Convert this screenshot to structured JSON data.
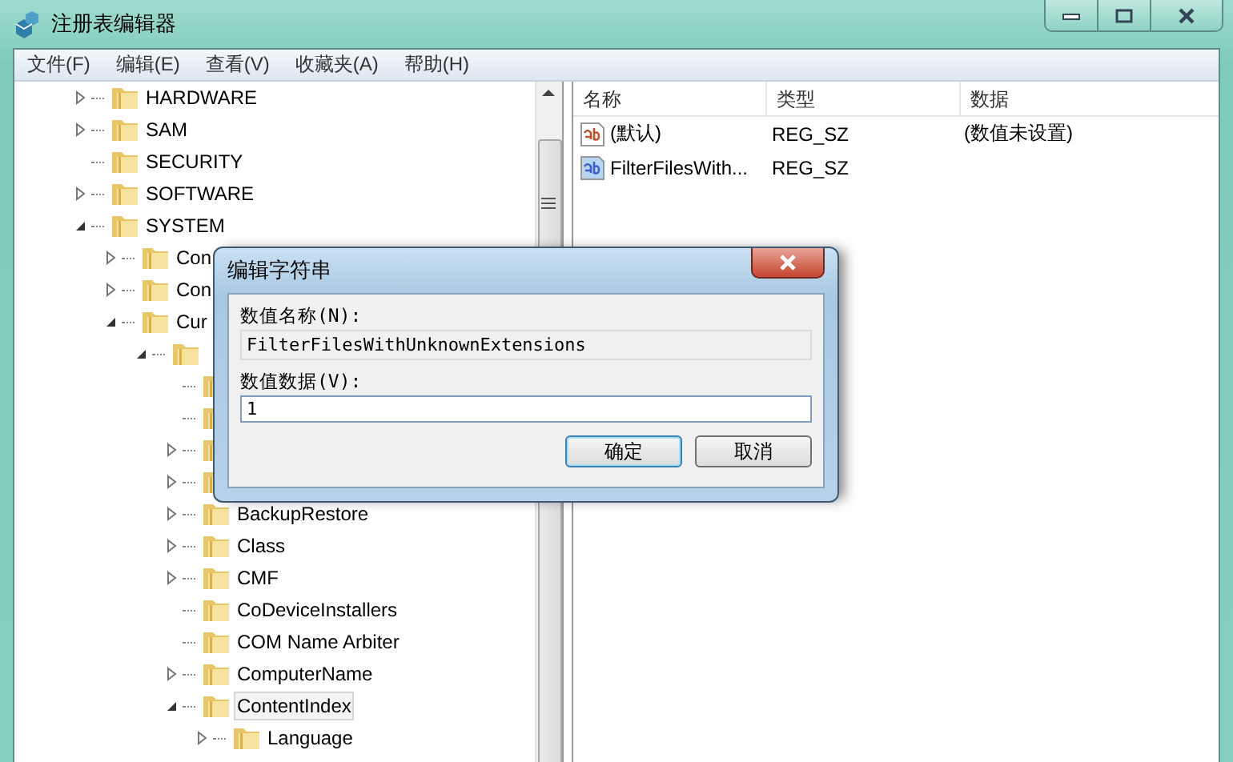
{
  "window": {
    "title": "注册表编辑器"
  },
  "menu": [
    {
      "label": "文件(F)"
    },
    {
      "label": "编辑(E)"
    },
    {
      "label": "查看(V)"
    },
    {
      "label": "收藏夹(A)"
    },
    {
      "label": "帮助(H)"
    }
  ],
  "tree": [
    {
      "label": "HARDWARE",
      "has_children": true,
      "expanded": false,
      "selected": false
    },
    {
      "label": "SAM",
      "has_children": true,
      "expanded": false,
      "selected": false
    },
    {
      "label": "SECURITY",
      "has_children": false,
      "selected": false
    },
    {
      "label": "SOFTWARE",
      "has_children": true,
      "expanded": false,
      "selected": false
    },
    {
      "label": "SYSTEM",
      "has_children": true,
      "expanded": true,
      "selected": false,
      "children": [
        {
          "label": "Con",
          "has_children": true,
          "expanded": false,
          "selected": false
        },
        {
          "label": "Con",
          "has_children": true,
          "expanded": false,
          "selected": false
        },
        {
          "label": "Cur",
          "has_children": true,
          "expanded": true,
          "selected": false,
          "children": [
            {
              "has_children": true,
              "expanded": true,
              "children": [
                {
                  "has_children": false
                },
                {
                  "has_children": false
                },
                {
                  "has_children": true,
                  "expanded": false
                },
                {
                  "has_children": true,
                  "expanded": false
                },
                {
                  "label": "BackupRestore",
                  "has_children": true,
                  "expanded": false,
                  "selected": false
                },
                {
                  "label": "Class",
                  "has_children": true,
                  "expanded": false,
                  "selected": false
                },
                {
                  "label": "CMF",
                  "has_children": true,
                  "expanded": false,
                  "selected": false
                },
                {
                  "label": "CoDeviceInstallers",
                  "has_children": false,
                  "selected": false
                },
                {
                  "label": "COM Name Arbiter",
                  "has_children": false,
                  "selected": false
                },
                {
                  "label": "ComputerName",
                  "has_children": true,
                  "expanded": false,
                  "selected": false
                },
                {
                  "label": "ContentIndex",
                  "has_children": true,
                  "expanded": true,
                  "selected": true,
                  "children": [
                    {
                      "label": "Language",
                      "has_children": true,
                      "expanded": false,
                      "selected": false
                    }
                  ]
                }
              ]
            }
          ]
        }
      ]
    }
  ],
  "values": {
    "columns": [
      "名称",
      "类型",
      "数据"
    ],
    "rows": [
      {
        "name": "(默认)",
        "type": "REG_SZ",
        "data": "(数值未设置)",
        "selected": false
      },
      {
        "name": "FilterFilesWith...",
        "type": "REG_SZ",
        "selected": true
      }
    ]
  },
  "dialog": {
    "title": "编辑字符串",
    "name_label": "数值名称(N):",
    "name_value": "FilterFilesWithUnknownExtensions",
    "data_label": "数值数据(V):",
    "data_value": "1",
    "buttons": [
      {
        "label": "确定",
        "default": true
      },
      {
        "label": "取消",
        "default": false
      }
    ]
  }
}
